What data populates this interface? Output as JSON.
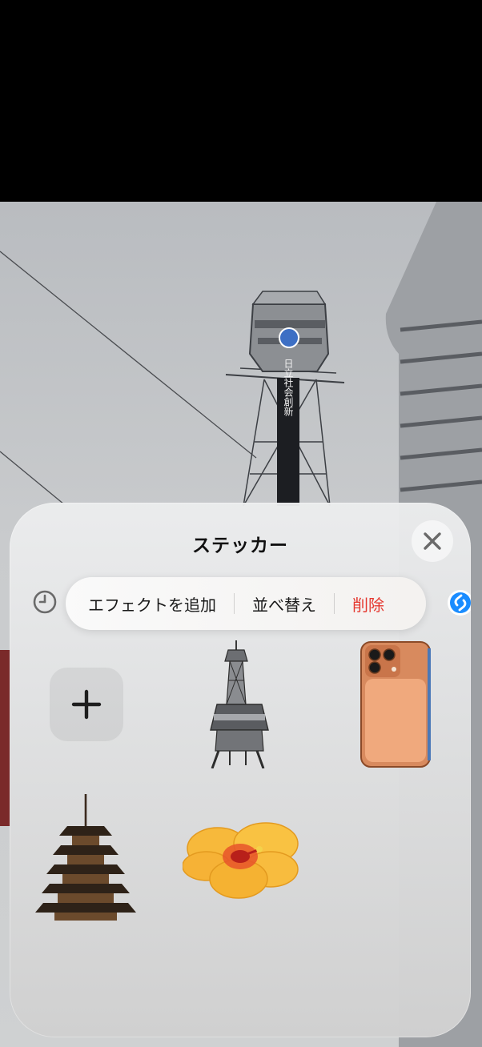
{
  "sheet": {
    "title": "ステッカー"
  },
  "toolbar": {
    "add_effect_label": "エフェクトを追加",
    "reorder_label": "並べ替え",
    "delete_label": "削除"
  },
  "photo_sign_text": "日立社会創新",
  "stickers": [
    {
      "name": "tower-sticker"
    },
    {
      "name": "phone-case-sticker"
    },
    {
      "name": "pagoda-sticker"
    },
    {
      "name": "hibiscus-sticker"
    }
  ],
  "colors": {
    "delete": "#e5372f",
    "shazam": "#1a8cff",
    "sheet_bg": "#e4e5e6"
  },
  "icons": {
    "close": "close-icon",
    "recent": "clock-icon",
    "add": "plus-icon",
    "shazam": "shazam-icon"
  }
}
